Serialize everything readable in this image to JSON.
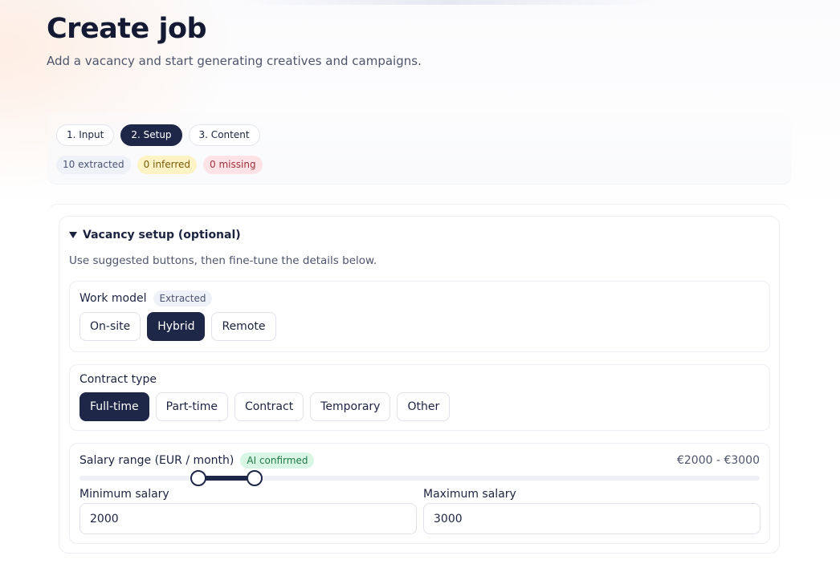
{
  "header": {
    "title": "Create job",
    "subtitle": "Add a vacancy and start generating creatives and campaigns."
  },
  "steps": [
    {
      "label": "1. Input",
      "active": false
    },
    {
      "label": "2. Setup",
      "active": true
    },
    {
      "label": "3. Content",
      "active": false
    }
  ],
  "badges": {
    "extracted": "10 extracted",
    "inferred": "0 inferred",
    "missing": "0 missing"
  },
  "setup": {
    "title": "Vacancy setup (optional)",
    "help": "Use suggested buttons, then fine-tune the details below.",
    "work_model": {
      "label": "Work model",
      "tag": "Extracted",
      "options": [
        "On-site",
        "Hybrid",
        "Remote"
      ],
      "selected": "Hybrid"
    },
    "contract_type": {
      "label": "Contract type",
      "options": [
        "Full-time",
        "Part-time",
        "Contract",
        "Temporary",
        "Other"
      ],
      "selected": "Full-time"
    },
    "salary": {
      "label": "Salary range (EUR / month)",
      "tag": "AI confirmed",
      "range_text": "€2000 - €3000",
      "slider": {
        "min_fraction": 0.175,
        "max_fraction": 0.257
      },
      "min_label": "Minimum salary",
      "min_value": "2000",
      "max_label": "Maximum salary",
      "max_value": "3000"
    }
  },
  "colors": {
    "primary": "#1e2747",
    "extracted_bg": "#eef1f7",
    "inferred_bg": "#fdf3c4",
    "missing_bg": "#fde2e6",
    "ai_bg": "#d9f5e4"
  }
}
